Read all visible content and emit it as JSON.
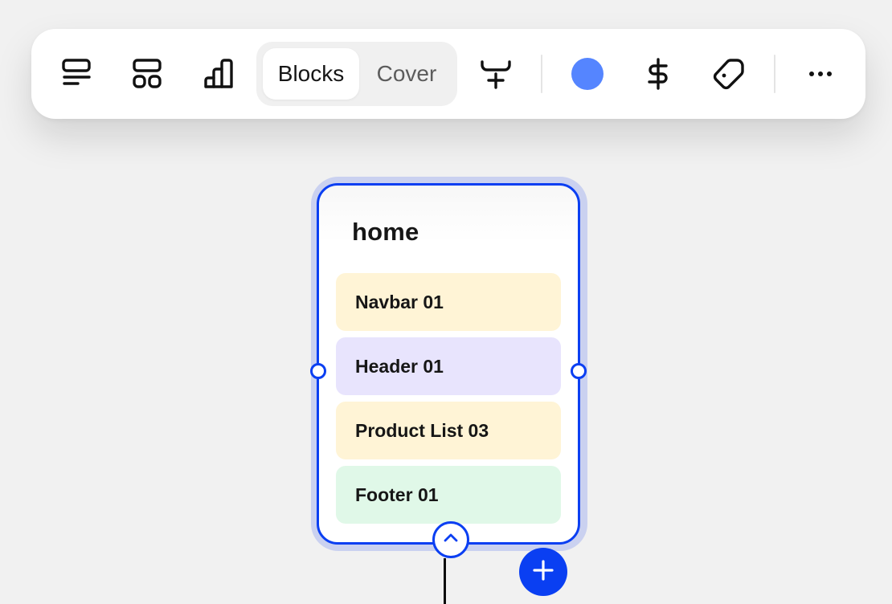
{
  "toolbar": {
    "icons": {
      "align_left": "align-left-icon",
      "layout_blocks": "layout-blocks-icon",
      "bar_chart": "bar-chart-icon",
      "insert_below": "insert-block-icon",
      "dollar": "dollar-icon",
      "tag": "tag-icon",
      "more": "more-horizontal-icon"
    },
    "view_toggle": {
      "options": [
        "Blocks",
        "Cover"
      ],
      "selected": "Blocks"
    },
    "color_swatch": "#5585ff"
  },
  "page_card": {
    "title": "home",
    "blocks": [
      {
        "label": "Navbar 01",
        "color": "#fff4d6"
      },
      {
        "label": "Header 01",
        "color": "#e8e4fd"
      },
      {
        "label": "Product List 03",
        "color": "#fff4d6"
      },
      {
        "label": "Footer 01",
        "color": "#e0f8e8"
      }
    ]
  },
  "colors": {
    "accent": "#0b3ff2",
    "add_button": "#0a3ff2"
  }
}
